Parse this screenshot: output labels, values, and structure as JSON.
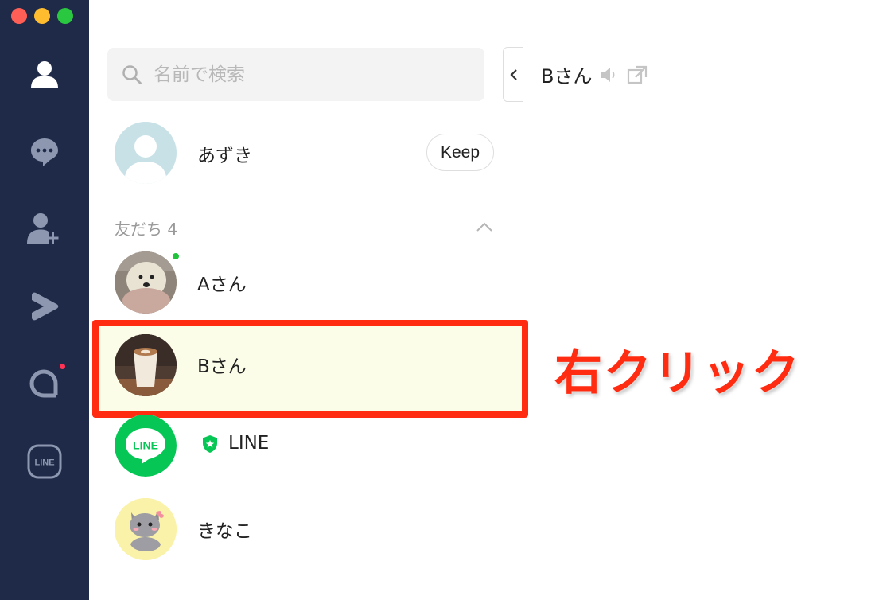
{
  "colors": {
    "rail_bg": "#1e2a47",
    "highlight_border": "#ff2c11",
    "highlight_fill": "#fcfde8",
    "line_green": "#06c755",
    "online_green": "#20c33b",
    "annotation": "#ff2c11"
  },
  "rail": {
    "items": [
      {
        "icon": "friends-icon"
      },
      {
        "icon": "chats-icon"
      },
      {
        "icon": "add-friend-icon"
      },
      {
        "icon": "voom-icon"
      },
      {
        "icon": "openchat-icon"
      },
      {
        "icon": "line-icon"
      }
    ]
  },
  "search": {
    "placeholder": "名前で検索"
  },
  "profile": {
    "name": "あずき",
    "keep_label": "Keep"
  },
  "friends": {
    "section_title": "友だち 4",
    "items": [
      {
        "name": "Aさん",
        "online": true
      },
      {
        "name": "Bさん",
        "selected": true
      },
      {
        "name": "LINE",
        "official": true
      },
      {
        "name": "きなこ"
      }
    ]
  },
  "chat": {
    "title": "Bさん"
  },
  "annotation": {
    "text": "右クリック"
  }
}
